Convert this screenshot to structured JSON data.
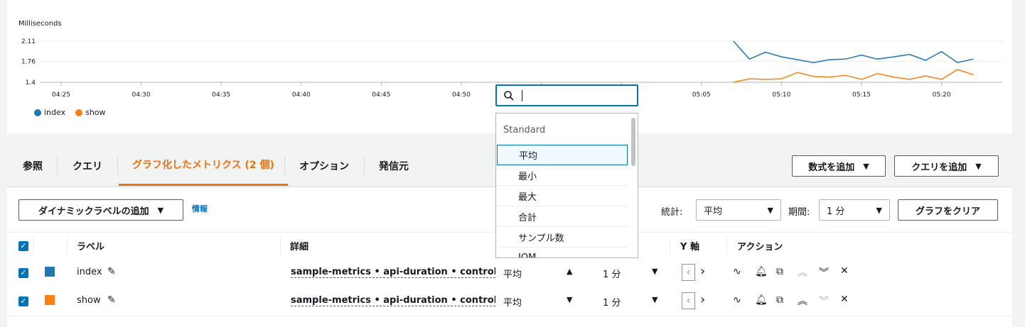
{
  "chart": {
    "ylabel": "Milliseconds",
    "yticks": [
      "2.11",
      "1.76",
      "1.4"
    ],
    "xticks": [
      "04:25",
      "04:30",
      "04:35",
      "04:40",
      "04:45",
      "04:50",
      "",
      "",
      "05:05",
      "05:10",
      "05:15",
      "05:20"
    ],
    "legend": [
      {
        "name": "index",
        "color": "#1f77b4"
      },
      {
        "name": "show",
        "color": "#ff7f0e"
      }
    ]
  },
  "chart_data": {
    "type": "line",
    "ylabel": "Milliseconds",
    "ylim": [
      1.4,
      2.11
    ],
    "x": [
      "05:07",
      "05:08",
      "05:09",
      "05:10",
      "05:11",
      "05:12",
      "05:13",
      "05:14",
      "05:15",
      "05:16",
      "05:17",
      "05:18",
      "05:19",
      "05:20",
      "05:21",
      "05:22"
    ],
    "series": [
      {
        "name": "index",
        "values": [
          2.11,
          1.8,
          1.92,
          1.84,
          1.79,
          1.74,
          1.79,
          1.8,
          1.87,
          1.8,
          1.84,
          1.88,
          1.78,
          1.93,
          1.74,
          1.8
        ]
      },
      {
        "name": "show",
        "values": [
          1.4,
          1.46,
          1.45,
          1.46,
          1.57,
          1.5,
          1.49,
          1.52,
          1.45,
          1.55,
          1.49,
          1.45,
          1.51,
          1.45,
          1.62,
          1.53
        ]
      }
    ]
  },
  "tabs": [
    {
      "label": "参照"
    },
    {
      "label": "クエリ"
    },
    {
      "label": "グラフ化したメトリクス (2 個)"
    },
    {
      "label": "オプション"
    },
    {
      "label": "発信元"
    }
  ],
  "buttons": {
    "add_math": "数式を追加",
    "add_query": "クエリを追加",
    "dynamic_label": "ダイナミックラベルの追加",
    "clear_graph": "グラフをクリア"
  },
  "info_link": "情報",
  "stat_label": "統計:",
  "stat_value": "平均",
  "period_label": "期間:",
  "period_value": "1 分",
  "table": {
    "headers": {
      "label": "ラベル",
      "details": "詳細",
      "yaxis": "Y 軸",
      "actions": "アクション"
    },
    "rows": [
      {
        "label": "index",
        "color": "#1f77b4",
        "details": "sample-metrics • api-duration • controller: Us",
        "stat": "平均",
        "period": "1 分"
      },
      {
        "label": "show",
        "color": "#ff7f0e",
        "details": "sample-metrics • api-duration • controller: Us",
        "stat": "平均",
        "period": "1 分"
      }
    ]
  },
  "dropdown": {
    "search_value": "",
    "group": "Standard",
    "items": [
      "平均",
      "最小",
      "最大",
      "合計",
      "サンプル数",
      "IQM"
    ],
    "highlighted": "平均"
  }
}
